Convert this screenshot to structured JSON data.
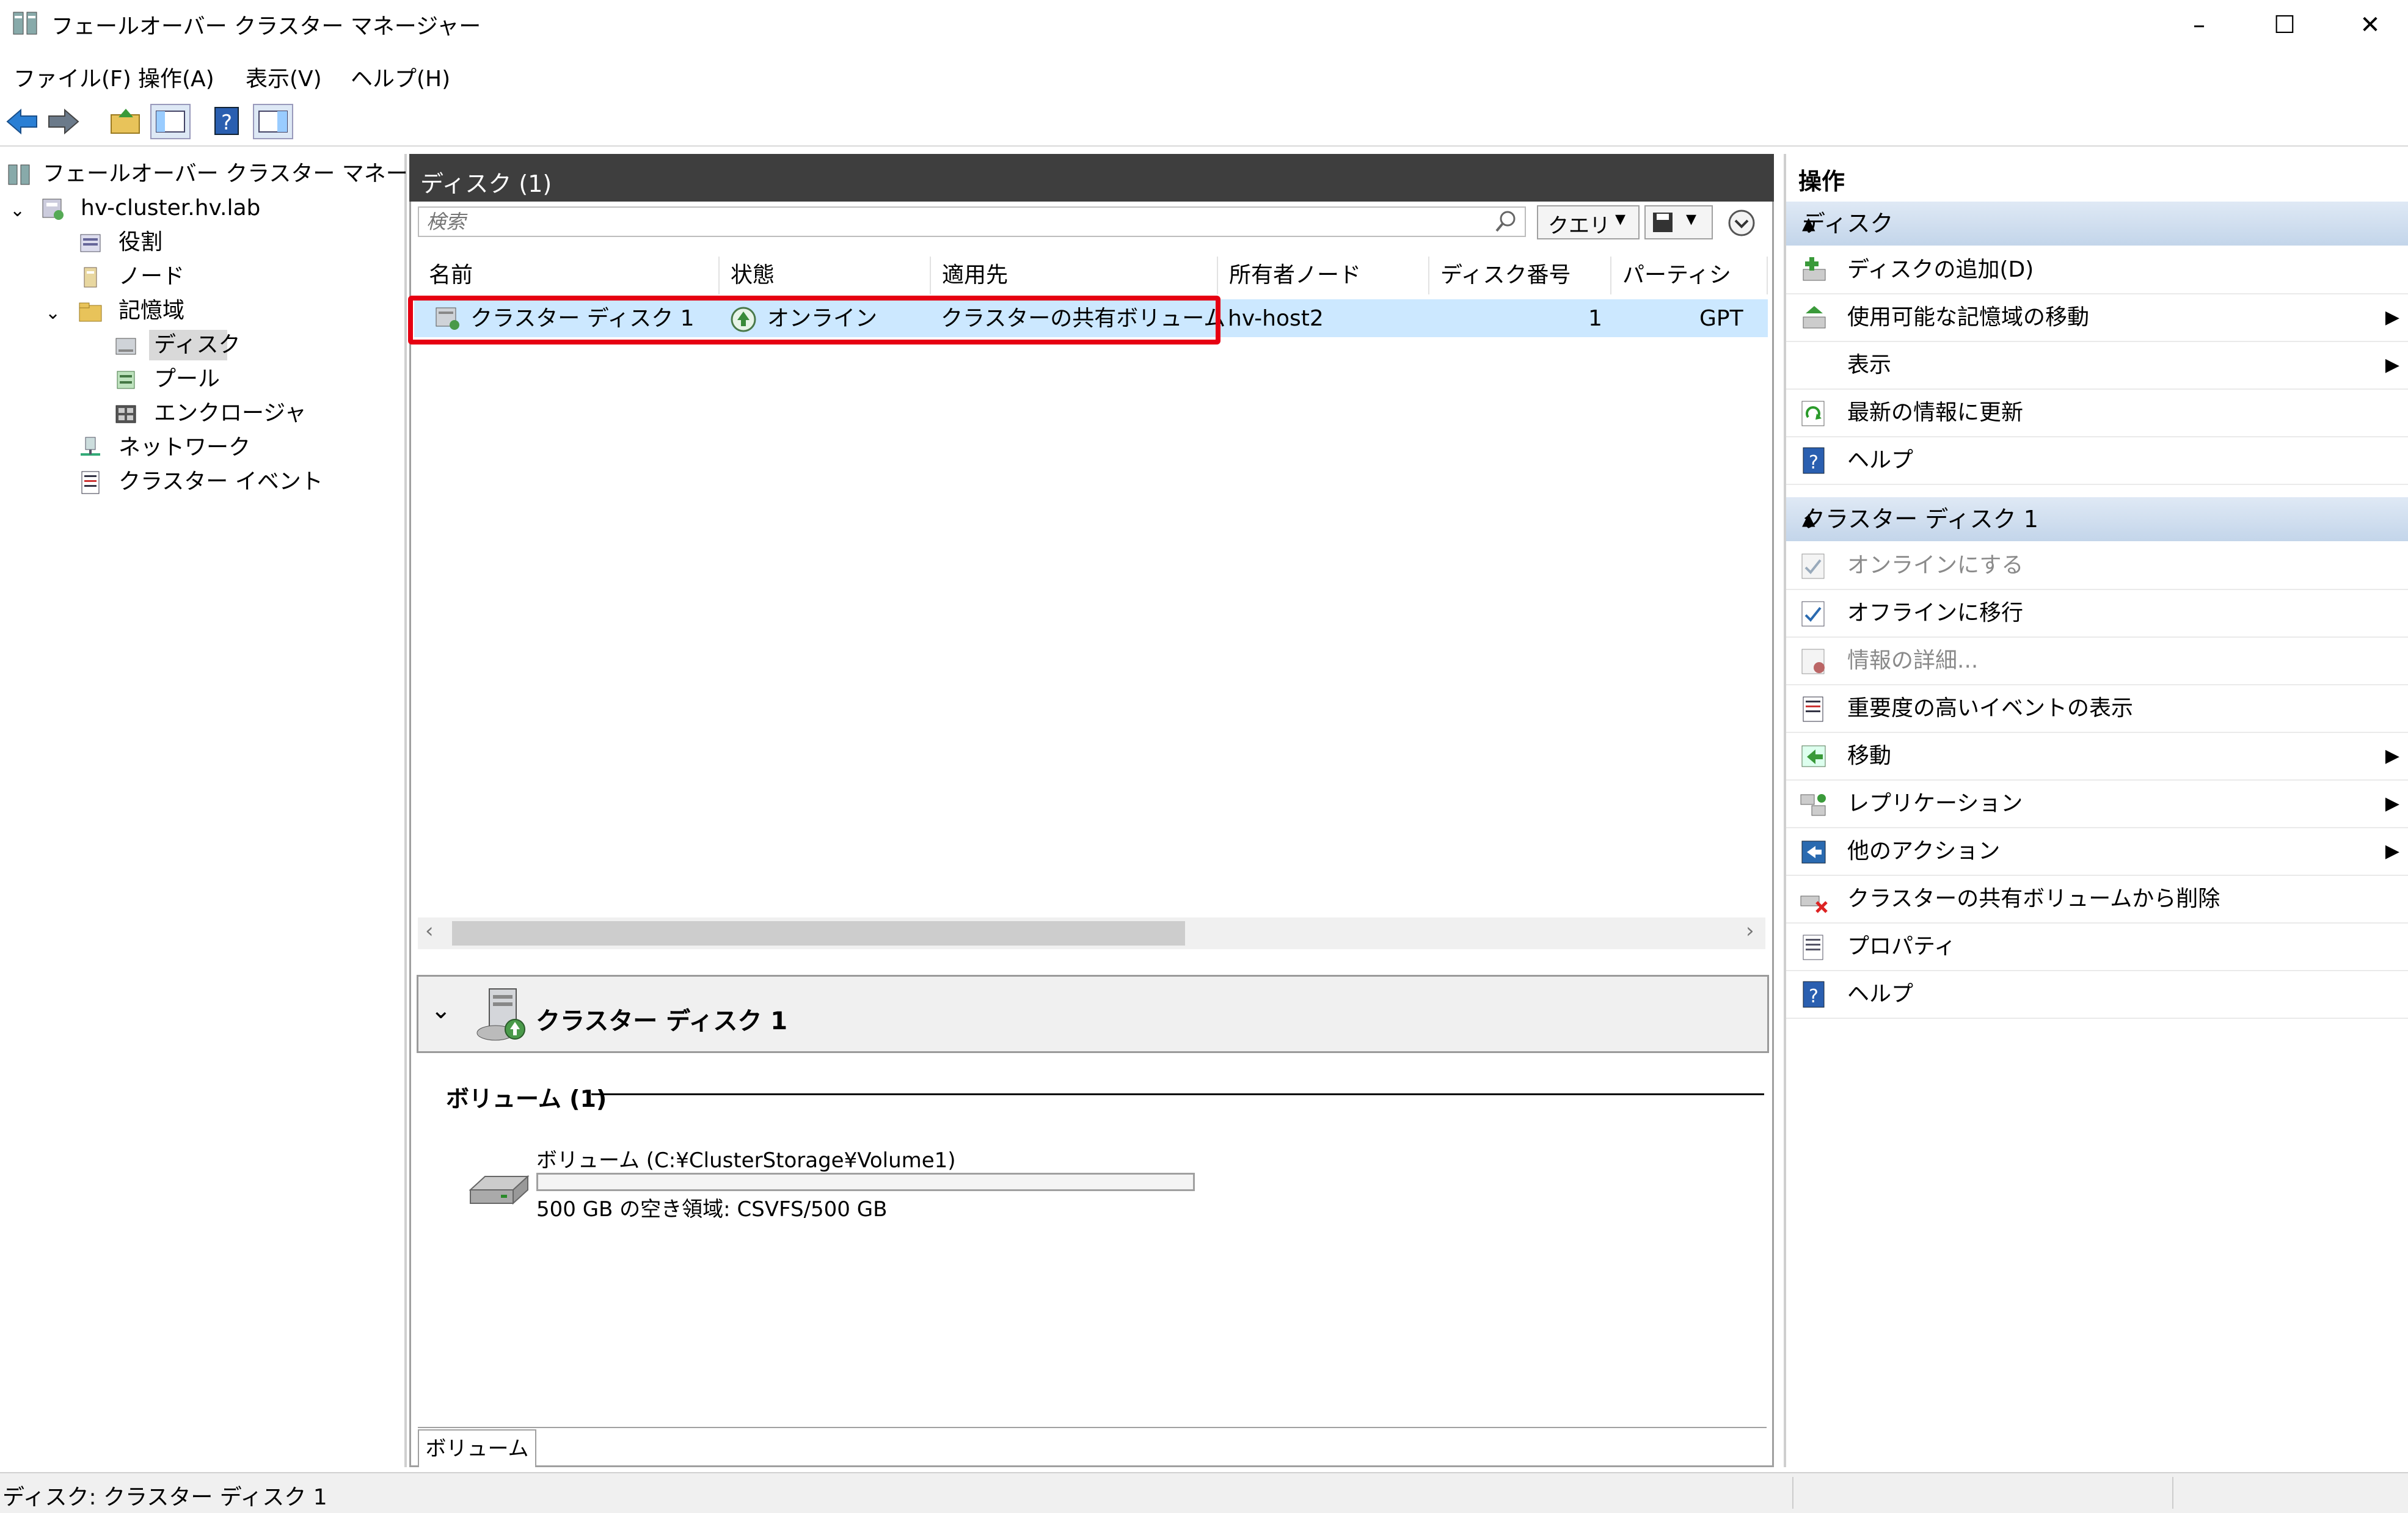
{
  "window": {
    "title": "フェールオーバー クラスター マネージャー",
    "minimize": "–",
    "maximize": "☐",
    "close": "✕"
  },
  "menu": [
    "ファイル(F)",
    "操作(A)",
    "表示(V)",
    "ヘルプ(H)"
  ],
  "tree": {
    "root": "フェールオーバー クラスター マネージャー",
    "cluster": "hv-cluster.hv.lab",
    "roles": "役割",
    "nodes": "ノード",
    "storage": "記憶域",
    "disks": "ディスク",
    "pools": "プール",
    "enclosures": "エンクロージャ",
    "networks": "ネットワーク",
    "events": "クラスター イベント"
  },
  "center": {
    "header": "ディスク (1)",
    "search_placeholder": "検索",
    "query_label": "クエリ",
    "columns": [
      "名前",
      "状態",
      "適用先",
      "所有者ノード",
      "ディスク番号",
      "パーティショ…"
    ],
    "rows": [
      {
        "name": "クラスター ディスク 1",
        "status": "オンライン",
        "assigned_to": "クラスターの共有ボリューム",
        "owner": "hv-host2",
        "disk_number": "1",
        "partition": "GPT"
      }
    ]
  },
  "detail": {
    "title": "クラスター ディスク 1",
    "volumes_label": "ボリューム (1)",
    "volume_name": "ボリューム (C:¥ClusterStorage¥Volume1)",
    "volume_space": "500 GB の空き領域: CSVFS/500 GB",
    "volume_used_fraction": 0.0,
    "tab": "ボリューム"
  },
  "actions": {
    "header": "操作",
    "section1": {
      "title": "ディスク",
      "items": [
        "ディスクの追加(D)",
        "使用可能な記憶域の移動",
        "表示",
        "最新の情報に更新",
        "ヘルプ"
      ]
    },
    "section2": {
      "title": "クラスター ディスク 1",
      "items": [
        "オンラインにする",
        "オフラインに移行",
        "情報の詳細...",
        "重要度の高いイベントの表示",
        "移動",
        "レプリケーション",
        "他のアクション",
        "クラスターの共有ボリュームから削除",
        "プロパティ",
        "ヘルプ"
      ]
    }
  },
  "status_bar": "ディスク: クラスター ディスク 1",
  "colors": {
    "selection": "#cce8ff",
    "highlight": "#e60012",
    "header_dark": "#3e3e3e",
    "accent_blue": "#1e6fc4"
  }
}
